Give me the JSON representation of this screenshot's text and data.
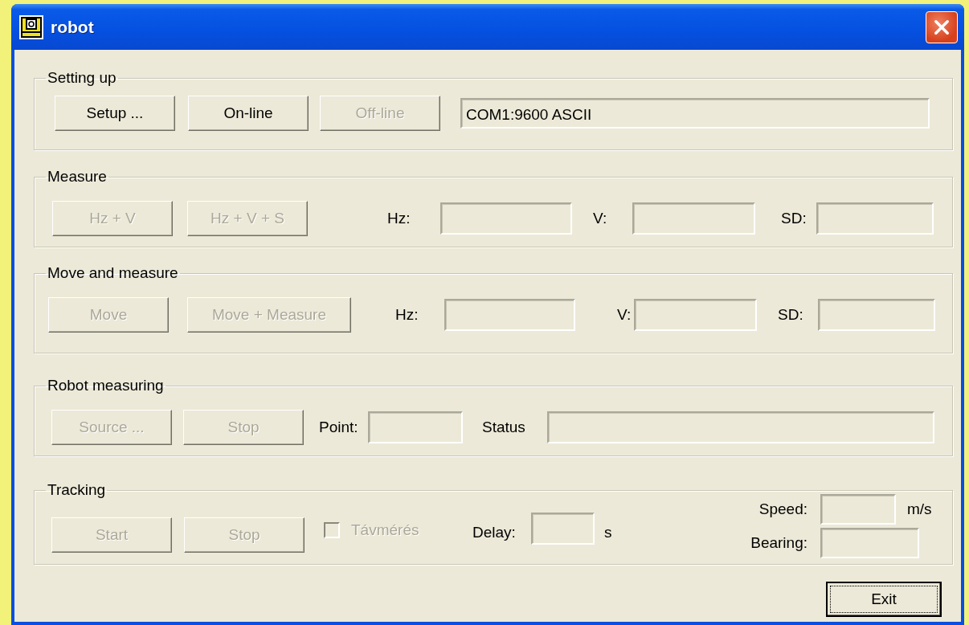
{
  "window": {
    "title": "robot"
  },
  "sections": [
    {
      "title": "Setting up",
      "controls": [
        {
          "kind": "button",
          "label": "Setup ...",
          "disabled": false
        },
        {
          "kind": "button",
          "label": "On-line",
          "disabled": false
        },
        {
          "kind": "button",
          "label": "Off-line",
          "disabled": true
        },
        {
          "kind": "field",
          "value": "COM1:9600 ASCII"
        }
      ]
    },
    {
      "title": "Measure",
      "controls": [
        {
          "kind": "button",
          "label": "Hz + V",
          "disabled": true
        },
        {
          "kind": "button",
          "label": "Hz + V + S",
          "disabled": true
        },
        {
          "kind": "label",
          "text": "Hz:"
        },
        {
          "kind": "field"
        },
        {
          "kind": "label",
          "text": "V:"
        },
        {
          "kind": "field"
        },
        {
          "kind": "label",
          "text": "SD:"
        },
        {
          "kind": "field"
        }
      ]
    },
    {
      "title": "Move and measure",
      "controls": [
        {
          "kind": "button",
          "label": "Move",
          "disabled": true
        },
        {
          "kind": "button",
          "label": "Move + Measure",
          "disabled": true
        },
        {
          "kind": "label",
          "text": "Hz:"
        },
        {
          "kind": "field"
        },
        {
          "kind": "label",
          "text": "V:"
        },
        {
          "kind": "field"
        },
        {
          "kind": "label",
          "text": "SD:"
        },
        {
          "kind": "field"
        }
      ]
    },
    {
      "title": "Robot measuring",
      "controls": [
        {
          "kind": "button",
          "label": "Source ...",
          "disabled": true
        },
        {
          "kind": "button",
          "label": "Stop",
          "disabled": true
        },
        {
          "kind": "label",
          "text": "Point:"
        },
        {
          "kind": "field"
        },
        {
          "kind": "label",
          "text": "Status"
        },
        {
          "kind": "field"
        }
      ]
    },
    {
      "title": "Tracking",
      "controls": [
        {
          "kind": "button",
          "label": "Start",
          "disabled": true
        },
        {
          "kind": "button",
          "label": "Stop",
          "disabled": true
        },
        {
          "kind": "checkbox",
          "label": "Távmérés",
          "checked": false,
          "disabled": true
        },
        {
          "kind": "label",
          "text": "Delay:"
        },
        {
          "kind": "field"
        },
        {
          "kind": "label",
          "text": "s"
        }
      ],
      "side": [
        {
          "label": "Speed:",
          "unit": "m/s"
        },
        {
          "label": "Bearing:"
        }
      ]
    }
  ],
  "buttons": [
    {
      "label": "Exit",
      "focused": true
    }
  ]
}
